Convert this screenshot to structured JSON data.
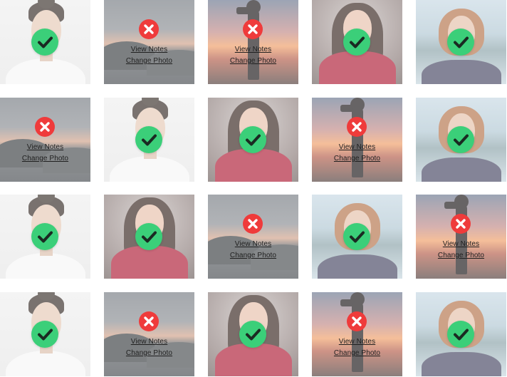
{
  "links": {
    "view_notes": "View Notes",
    "change_photo": "Change Photo"
  },
  "colors": {
    "accepted": "#3bcf79",
    "rejected": "#ef3b3b"
  },
  "icons": {
    "accepted": "check-icon",
    "rejected": "close-icon"
  },
  "tiles": [
    {
      "photo": "bun",
      "status": "accepted"
    },
    {
      "photo": "sea",
      "status": "rejected"
    },
    {
      "photo": "sunset",
      "status": "rejected"
    },
    {
      "photo": "red",
      "status": "accepted"
    },
    {
      "photo": "bob",
      "status": "accepted"
    },
    {
      "photo": "sea",
      "status": "rejected"
    },
    {
      "photo": "bun",
      "status": "accepted"
    },
    {
      "photo": "red",
      "status": "accepted"
    },
    {
      "photo": "sunset",
      "status": "rejected"
    },
    {
      "photo": "bob",
      "status": "accepted"
    },
    {
      "photo": "bun",
      "status": "accepted"
    },
    {
      "photo": "red",
      "status": "accepted"
    },
    {
      "photo": "sea",
      "status": "rejected"
    },
    {
      "photo": "bob",
      "status": "accepted"
    },
    {
      "photo": "sunset",
      "status": "rejected"
    },
    {
      "photo": "bun",
      "status": "accepted"
    },
    {
      "photo": "sea",
      "status": "rejected"
    },
    {
      "photo": "red",
      "status": "accepted"
    },
    {
      "photo": "sunset",
      "status": "rejected"
    },
    {
      "photo": "bob",
      "status": "accepted"
    }
  ]
}
